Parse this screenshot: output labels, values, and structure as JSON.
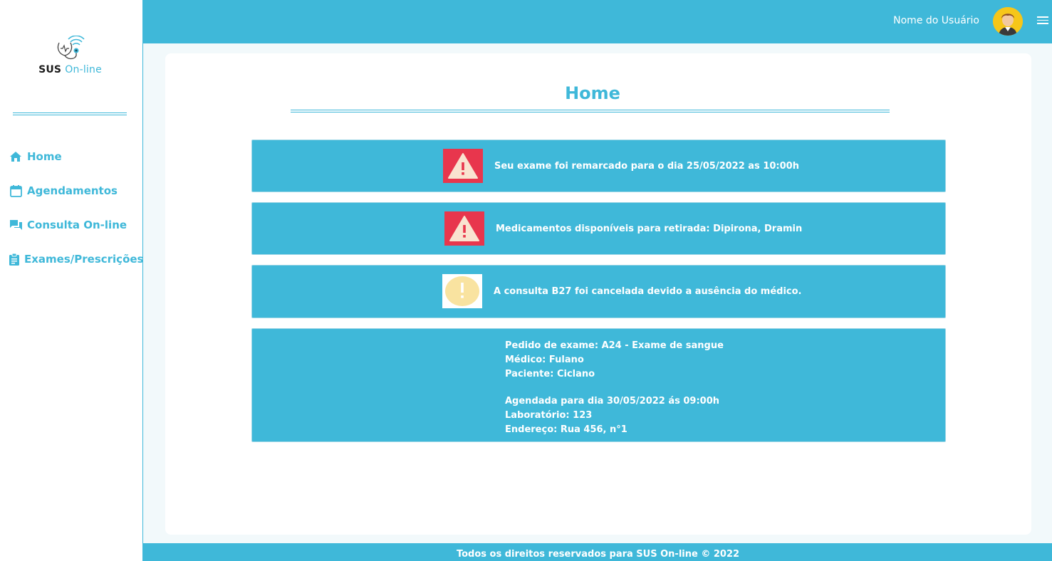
{
  "brand": {
    "name_bold": "SUS",
    "name_light": "On-line"
  },
  "sidebar": {
    "items": [
      {
        "label": "Home",
        "icon": "home-icon"
      },
      {
        "label": "Agendamentos",
        "icon": "calendar-icon"
      },
      {
        "label": "Consulta On-line",
        "icon": "chat-icon"
      },
      {
        "label": "Exames/Prescrições",
        "icon": "clipboard-icon"
      }
    ]
  },
  "header": {
    "user_name": "Nome do Usuário"
  },
  "main": {
    "title": "Home",
    "notices": [
      {
        "text": "Seu exame foi remarcado para o dia 25/05/2022 as 10:00h",
        "icon": "warning-triangle-icon"
      },
      {
        "text": "Medicamentos disponíveis para retirada: Dipirona, Dramin",
        "icon": "warning-triangle-icon"
      },
      {
        "text": "A consulta B27 foi cancelada devido a ausência do médico.",
        "icon": "exclamation-circle-icon"
      }
    ],
    "exam_order": {
      "line1": "Pedido de exame: A24 - Exame de sangue",
      "line2": "Médico: Fulano",
      "line3": "Paciente: Ciclano",
      "line4": "Agendada para dia 30/05/2022 ás 09:00h",
      "line5": "Laboratório: 123",
      "line6": "Endereço: Rua 456, n°1"
    }
  },
  "footer": {
    "text": "Todos os direitos reservados para SUS On-line © 2022"
  },
  "colors": {
    "primary": "#3fb8d9",
    "alert_red": "#e8364d",
    "warning_yellow": "#f9e3a0",
    "background": "#f2f9fb"
  }
}
